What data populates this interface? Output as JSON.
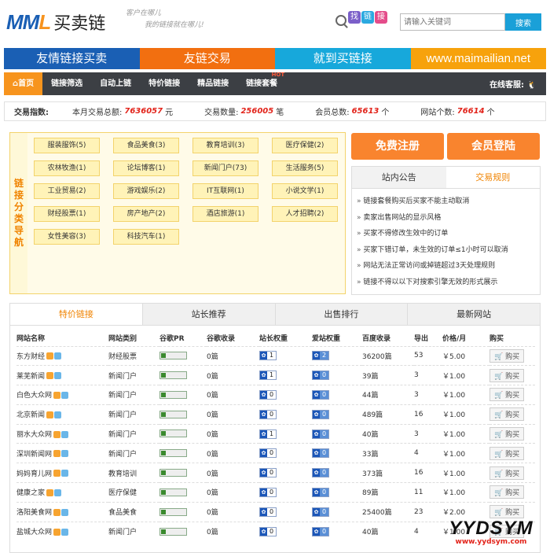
{
  "header": {
    "logo_mark_blue": "MM",
    "logo_mark_orange": "L",
    "logo_cn": "买卖链",
    "slogan1": "客户在哪儿",
    "slogan2": "我的链接就在哪儿!",
    "find_tag": [
      "找",
      "链",
      "接"
    ],
    "search_placeholder": "请输入关键词",
    "search_button": "搜索"
  },
  "banner": [
    {
      "label": "友情链接买卖",
      "color": "#1a5fb4"
    },
    {
      "label": "友链交易",
      "color": "#f26f10"
    },
    {
      "label": "就到买链接",
      "color": "#17a8db"
    },
    {
      "label": "www.maimailian.net",
      "color": "#f7a20c"
    }
  ],
  "nav": {
    "items": [
      "首页",
      "链接筛选",
      "自动上链",
      "特价链接",
      "精品链接",
      "链接套餐"
    ],
    "hot": "HOT",
    "qq": "在线客服:"
  },
  "stats": {
    "label": "交易指数:",
    "total_label": "本月交易总额:",
    "total": "7636057",
    "total_unit": "元",
    "count_label": "交易数量:",
    "count": "256005",
    "count_unit": "笔",
    "members_label": "会员总数:",
    "members": "65613",
    "members_unit": "个",
    "sites_label": "网站个数:",
    "sites": "76614",
    "sites_unit": "个"
  },
  "categories": {
    "title": "链接分类导航",
    "items": [
      "服装服饰(5)",
      "食品美食(3)",
      "教育培训(3)",
      "医疗保健(2)",
      "农林牧渔(1)",
      "论坛博客(1)",
      "新闻门户(73)",
      "生活服务(5)",
      "工业贸易(2)",
      "游戏娱乐(2)",
      "IT互联网(1)",
      "小说文学(1)",
      "财经股票(1)",
      "房产地产(2)",
      "酒店旅游(1)",
      "人才招聘(2)",
      "女性美容(3)",
      "科技汽车(1)"
    ]
  },
  "actions": {
    "register": "免费注册",
    "login": "会员登陆"
  },
  "notice": {
    "tab1": "站内公告",
    "tab2": "交易规则",
    "items": [
      "链接套餐购买后买家不能主动取消",
      "卖家出售网站的显示风格",
      "买家不得修改生效中的订单",
      "买家下错订单，未生效的订单≤1小时可以取消",
      "网站无法正常访问或掉链超过3天处理规则",
      "链接不得以以下对搜索引擎无效的形式展示"
    ]
  },
  "table": {
    "tabs": [
      "特价链接",
      "站长推荐",
      "出售排行",
      "最新网站"
    ],
    "headers": [
      "网站名称",
      "网站类别",
      "谷歌PR",
      "谷歌收录",
      "站长权重",
      "爱站权重",
      "百度收录",
      "导出",
      "价格/月",
      "购买"
    ],
    "buy_label": "购买",
    "rows": [
      {
        "name": "东方财经",
        "cat": "财经股票",
        "gpr": "0",
        "gidx": "0篇",
        "zz": "1",
        "az": "2",
        "bd": "36200篇",
        "out": "53",
        "price": "￥5.00"
      },
      {
        "name": "莱芜新闻",
        "cat": "新闻门户",
        "gpr": "0",
        "gidx": "0篇",
        "zz": "1",
        "az": "0",
        "bd": "39篇",
        "out": "3",
        "price": "￥1.00"
      },
      {
        "name": "白色大众网",
        "cat": "新闻门户",
        "gpr": "0",
        "gidx": "0篇",
        "zz": "0",
        "az": "0",
        "bd": "44篇",
        "out": "3",
        "price": "￥1.00"
      },
      {
        "name": "北京新闻",
        "cat": "新闻门户",
        "gpr": "0",
        "gidx": "0篇",
        "zz": "0",
        "az": "0",
        "bd": "489篇",
        "out": "16",
        "price": "￥1.00"
      },
      {
        "name": "丽水大众网",
        "cat": "新闻门户",
        "gpr": "0",
        "gidx": "0篇",
        "zz": "1",
        "az": "0",
        "bd": "40篇",
        "out": "3",
        "price": "￥1.00"
      },
      {
        "name": "深圳新闻网",
        "cat": "新闻门户",
        "gpr": "0",
        "gidx": "0篇",
        "zz": "0",
        "az": "0",
        "bd": "33篇",
        "out": "4",
        "price": "￥1.00"
      },
      {
        "name": "妈妈育儿网",
        "cat": "教育培训",
        "gpr": "0",
        "gidx": "0篇",
        "zz": "0",
        "az": "0",
        "bd": "373篇",
        "out": "16",
        "price": "￥1.00"
      },
      {
        "name": "健康之家",
        "cat": "医疗保健",
        "gpr": "0",
        "gidx": "0篇",
        "zz": "0",
        "az": "0",
        "bd": "89篇",
        "out": "11",
        "price": "￥1.00"
      },
      {
        "name": "洛阳美食网",
        "cat": "食品美食",
        "gpr": "0",
        "gidx": "0篇",
        "zz": "0",
        "az": "0",
        "bd": "25400篇",
        "out": "23",
        "price": "￥2.00"
      },
      {
        "name": "盐城大众网",
        "cat": "新闻门户",
        "gpr": "0",
        "gidx": "0篇",
        "zz": "0",
        "az": "0",
        "bd": "40篇",
        "out": "4",
        "price": "￥1.00"
      }
    ]
  },
  "watermark": {
    "big": "YYDSYM",
    "small": "www.yydsym.com"
  }
}
